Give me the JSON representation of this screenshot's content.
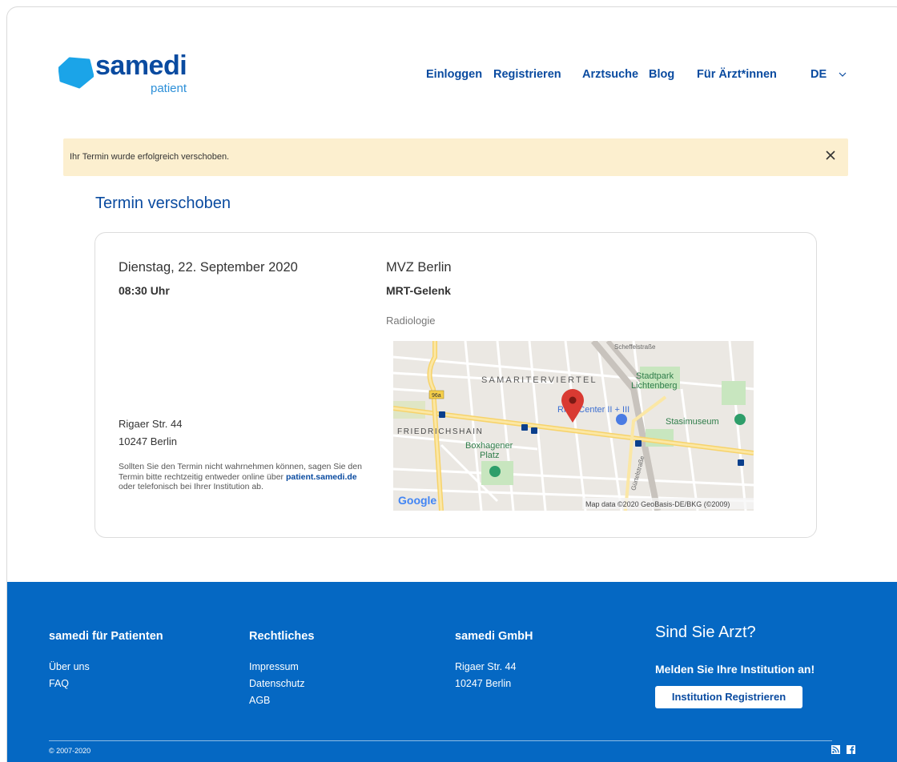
{
  "brand": {
    "name": "samedi",
    "sub": "patient",
    "primary": "#0a4ba0",
    "accent": "#1ba4e8"
  },
  "nav": {
    "items": [
      "Einloggen",
      "Registrieren",
      "Arztsuche",
      "Blog",
      "Für Ärzt*innen"
    ],
    "language": "DE"
  },
  "alert": {
    "text": "Ihr Termin wurde erfolgreich verschoben.",
    "close_icon": "close-icon",
    "background": "#fcefcf"
  },
  "page": {
    "title": "Termin verschoben"
  },
  "appointment": {
    "date": "Dienstag, 22. September 2020",
    "time": "08:30 Uhr",
    "institution": "MVZ Berlin",
    "service": "MRT-Gelenk",
    "department": "Radiologie",
    "address_line1": "Rigaer Str. 44",
    "address_line2": "10247 Berlin",
    "note_pre": "Sollten Sie den Termin nicht wahrnehmen können, sagen Sie den Termin bitte rechtzeitig entweder online über ",
    "note_link": "patient.samedi.de",
    "note_post": " oder telefonisch bei Ihrer Institution ab."
  },
  "map": {
    "labels": [
      "SAMARITERVIERTEL",
      "Stadtpark",
      "Lichtenberg",
      "FRIEDRICHSHAIN",
      "Boxhagener",
      "Platz",
      "Ring-Center II + III",
      "Stasimuseum",
      "Scheffelstraße",
      "Gürtelstraße",
      "96a"
    ],
    "google": "Google",
    "attribution": "Map data ©2020 GeoBasis-DE/BKG (©2009)"
  },
  "footer": {
    "col1": {
      "heading": "samedi für Patienten",
      "links": [
        "Über uns",
        "FAQ"
      ]
    },
    "col2": {
      "heading": "Rechtliches",
      "links": [
        "Impressum",
        "Datenschutz",
        "AGB"
      ]
    },
    "col3": {
      "heading": "samedi GmbH",
      "lines": [
        "Rigaer Str. 44",
        "10247 Berlin"
      ]
    },
    "col4": {
      "heading": "Sind Sie Arzt?",
      "cta": "Melden Sie Ihre Institution an!",
      "button": "Institution Registrieren"
    },
    "copyright": "© 2007-2020",
    "icons": [
      "rss-icon",
      "facebook-icon"
    ],
    "background": "#0568c3"
  }
}
